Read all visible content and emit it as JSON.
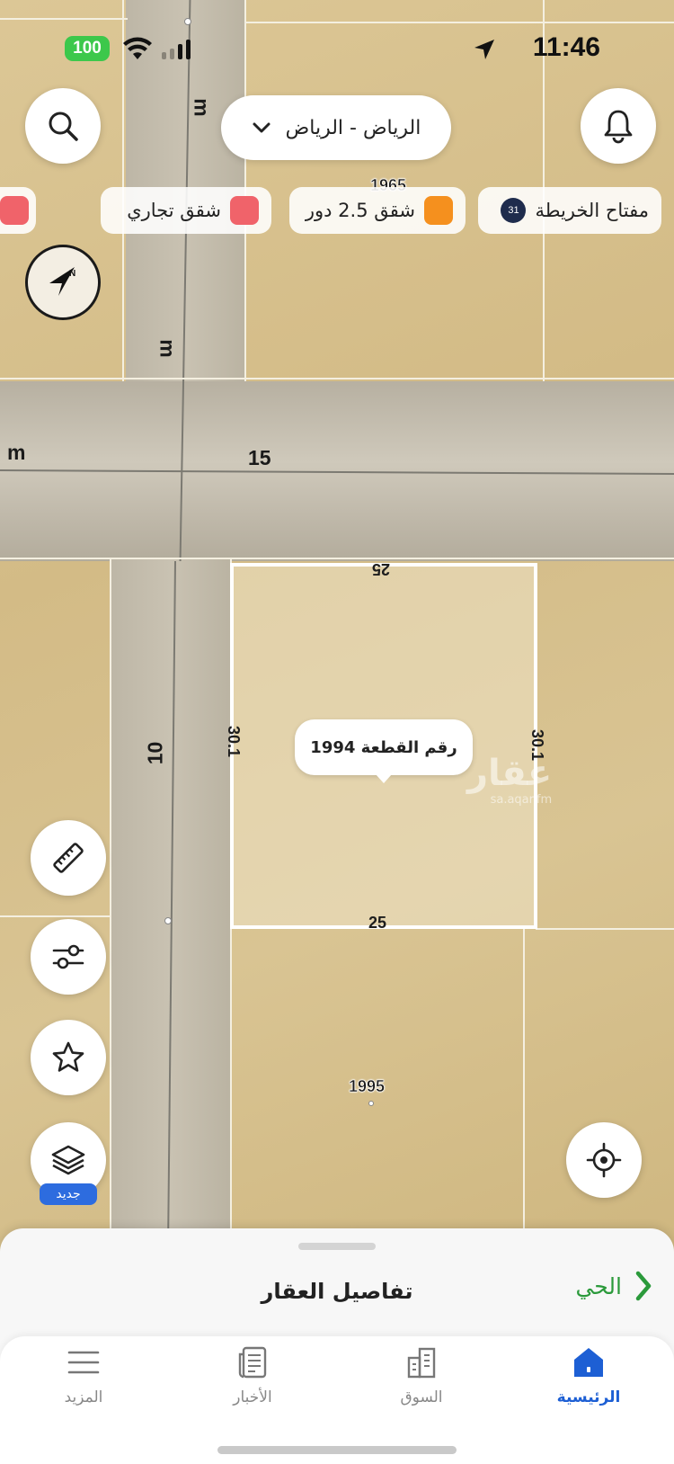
{
  "status_bar": {
    "battery": "100",
    "time": "11:46"
  },
  "header": {
    "city_selector": "الرياض - الرياض"
  },
  "legend": {
    "map_key_label": "مفتاح الخريطة",
    "map_key_count": "31",
    "items": [
      {
        "label": "شقق 2.5 دور",
        "color": "#f5901e"
      },
      {
        "label": "شقق تجاري",
        "color": "#f0636a"
      },
      {
        "label": "",
        "color": "#f0636a"
      }
    ]
  },
  "map": {
    "street_labels": [
      "m",
      "m",
      "m",
      "15",
      "10"
    ],
    "plot_numbers": [
      "1965",
      "1995"
    ],
    "selected_plot": {
      "callout": "رقم القطعة 1994",
      "dimensions": {
        "top": "25",
        "bottom": "25",
        "left": "30.1",
        "right": "30.1"
      }
    },
    "watermark": {
      "main": "عقار",
      "sub": "sa.aqar.fm"
    }
  },
  "side_tools": {
    "new_badge": "جديد"
  },
  "sheet": {
    "title": "تفاصيل العقار",
    "district_link": "الحي"
  },
  "tabbar": {
    "items": [
      {
        "label": "الرئيسية",
        "icon": "home-icon",
        "active": true
      },
      {
        "label": "السوق",
        "icon": "buildings-icon",
        "active": false
      },
      {
        "label": "الأخبار",
        "icon": "news-icon",
        "active": false
      },
      {
        "label": "المزيد",
        "icon": "menu-icon",
        "active": false
      }
    ]
  },
  "colors": {
    "accent": "#1d5fd4",
    "district_green": "#2b9a3b",
    "battery_green": "#3cc84b"
  }
}
